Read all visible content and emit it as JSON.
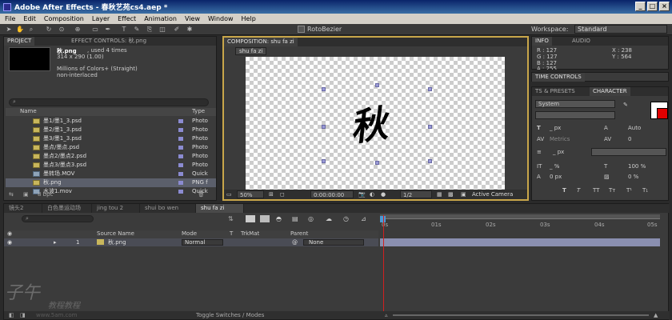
{
  "title": "Adobe After Effects - 春秋艺苑cs4.aep *",
  "menu": [
    "File",
    "Edit",
    "Composition",
    "Layer",
    "Effect",
    "Animation",
    "View",
    "Window",
    "Help"
  ],
  "toolbar": {
    "rotobezier": "RotoBezier",
    "workspace_label": "Workspace:",
    "workspace_value": "Standard"
  },
  "project": {
    "tabs": [
      "PROJECT",
      "EFFECT CONTROLS: 秋.png"
    ],
    "item_name": "秋.png",
    "used_times": ", used 4 times",
    "dimensions": "314 x 290 (1.00)",
    "colors": "Millions of Colors+ (Straight)",
    "interlace": "non-interlaced",
    "col_name": "Name",
    "col_type": "Type",
    "rows": [
      {
        "name": "墨1/墨1_3.psd",
        "type": "Photo",
        "icon": "psd"
      },
      {
        "name": "墨2/墨1_3.psd",
        "type": "Photo",
        "icon": "psd"
      },
      {
        "name": "墨3/墨1_3.psd",
        "type": "Photo",
        "icon": "psd"
      },
      {
        "name": "墨点/墨点.psd",
        "type": "Photo",
        "icon": "psd"
      },
      {
        "name": "墨点2/墨点2.psd",
        "type": "Photo",
        "icon": "psd"
      },
      {
        "name": "墨点3/墨点3.psd",
        "type": "Photo",
        "icon": "psd"
      },
      {
        "name": "墨转场.MOV",
        "type": "Quick",
        "icon": "mov"
      },
      {
        "name": "秋.png",
        "type": "PNG f",
        "icon": "png"
      },
      {
        "name": "水波1.mov",
        "type": "Quick",
        "icon": "mov"
      }
    ],
    "bpc": "8 bpc"
  },
  "composition": {
    "tab": "COMPOSITION: shu fa zi",
    "sub_tab": "shu fa zi",
    "glyph": "秋",
    "zoom": "50%",
    "timecode": "0:00:00:00",
    "resolution": "1/2",
    "camera": "Active Camera"
  },
  "info": {
    "tabs": [
      "INFO",
      "AUDIO"
    ],
    "r": "R : 127",
    "g": "G : 127",
    "b": "B : 127",
    "a": "A : 255",
    "x": "X : 238",
    "y": "Y : 564"
  },
  "time_controls": "TIME CONTROLS",
  "character": {
    "tabs": [
      "TS & PRESETS",
      "CHARACTER"
    ],
    "font": "System",
    "size": "_ px",
    "leading": "Auto",
    "metrics": "Metrics",
    "kerning": "0",
    "stroke": "_ px",
    "vscale": "_ %",
    "hscale": "100 %",
    "baseline": "0 px",
    "tsume": "0 %"
  },
  "timeline": {
    "tabs": [
      "镜头2",
      "白色墨运动场",
      "jing tou 2",
      "shui bo wen",
      "shu fa zi"
    ],
    "col_source": "Source Name",
    "col_mode": "Mode",
    "col_t": "T",
    "col_trkmat": "TrkMat",
    "col_parent": "Parent",
    "layer_num": "1",
    "layer_name": "秋.png",
    "layer_mode": "Normal",
    "layer_parent": "None",
    "ticks": [
      "0s",
      "01s",
      "02s",
      "03s",
      "04s",
      "05s"
    ],
    "footer": "Toggle Switches / Modes"
  },
  "watermark": {
    "logo": "子午",
    "text": "教程教程",
    "url": "www.5am.com"
  }
}
